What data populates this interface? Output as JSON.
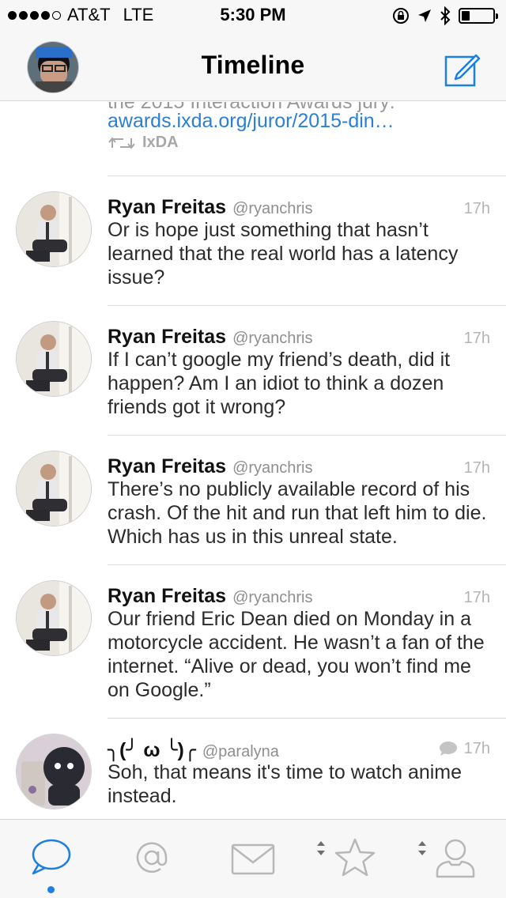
{
  "status_bar": {
    "carrier": "AT&T",
    "network": "LTE",
    "time": "5:30 PM",
    "signal_bars": 4,
    "signal_max": 5,
    "battery_level": 0.25
  },
  "nav": {
    "title": "Timeline"
  },
  "partial_tweet": {
    "cut_text": "the 2015 Interaction Awards jury:",
    "link": "awards.ixda.org/juror/2015-din…",
    "retweeted_by": "IxDA"
  },
  "tweets": [
    {
      "name": "Ryan Freitas",
      "handle": "@ryanchris",
      "time": "17h",
      "text": "Or is hope just something that hasn’t learned that the real world has a latency issue?"
    },
    {
      "name": "Ryan Freitas",
      "handle": "@ryanchris",
      "time": "17h",
      "text": "If I can’t google my friend’s death, did it happen? Am I an idiot to think a dozen friends got it wrong?"
    },
    {
      "name": "Ryan Freitas",
      "handle": "@ryanchris",
      "time": "17h",
      "text": "There’s no publicly available record of his crash. Of the hit and run that left him to die. Which has us in this unreal state."
    },
    {
      "name": "Ryan Freitas",
      "handle": "@ryanchris",
      "time": "17h",
      "text": "Our friend Eric Dean died on Monday in a motorcycle accident. He wasn’t a fan of the internet. “Alive or dead, you won’t find me on Google.”"
    },
    {
      "name": "╮(╯ ω ╰)╭",
      "handle": "@paralyna",
      "time": "17h",
      "text": "Soh, that means it's time to watch anime instead."
    }
  ],
  "tab_bar": {
    "active": "timeline",
    "tabs": [
      "timeline",
      "mentions",
      "messages",
      "favorites",
      "profile"
    ]
  },
  "colors": {
    "accent": "#1d7fe0",
    "link": "#2a7fd6",
    "tab_inactive": "#b7b7b7"
  }
}
